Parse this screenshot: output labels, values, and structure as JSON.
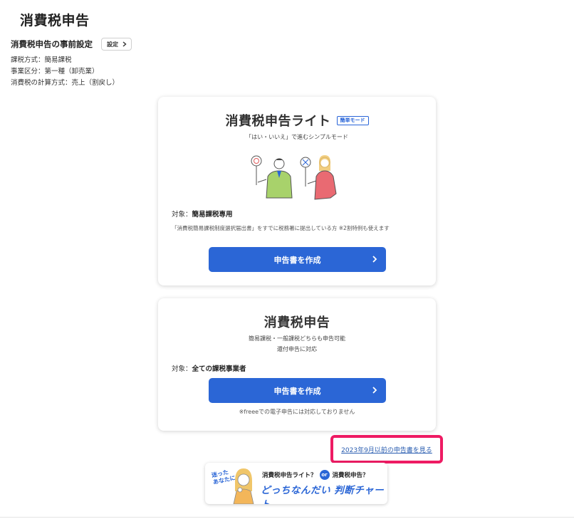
{
  "page": {
    "title": "消費税申告"
  },
  "settings": {
    "title": "消費税申告の事前設定",
    "button_label": "設定",
    "items": [
      "課税方式：簡易課税",
      "事業区分：第一種（卸売業）",
      "消費税の計算方式：売上（割戻し）"
    ]
  },
  "lite_card": {
    "title": "消費税申告ライト",
    "badge": "簡単モード",
    "subtitle": "「はい・いいえ」で進むシンプルモード",
    "target_prefix": "対象：",
    "target_value": "簡易課税専用",
    "note": "「消費税簡易課税制度選択届出書」をすでに税務署に提出している方 ※2割特例も使えます",
    "button_label": "申告書を作成"
  },
  "full_card": {
    "title": "消費税申告",
    "subtitle_line1": "簡易課税・一般課税どちらも申告可能",
    "subtitle_line2": "還付申告に対応",
    "target_prefix": "対象：",
    "target_value": "全ての課税事業者",
    "button_label": "申告書を作成",
    "footnote": "※freeeでの電子申告には対応しておりません"
  },
  "old_link": {
    "label": "2023年9月以前の申告書を見る"
  },
  "banner": {
    "question_line1": "迷った",
    "question_line2": "あなたに",
    "option1": "消費税申告ライト？",
    "or": "or",
    "option2": "消費税申告？",
    "headline": "どっちなんだい 判断チャート"
  },
  "colors": {
    "primary": "#2b66d6",
    "highlight": "#ee1b63",
    "link": "#2a5db0"
  },
  "icons": {
    "chevron": "chevron-right-icon"
  }
}
